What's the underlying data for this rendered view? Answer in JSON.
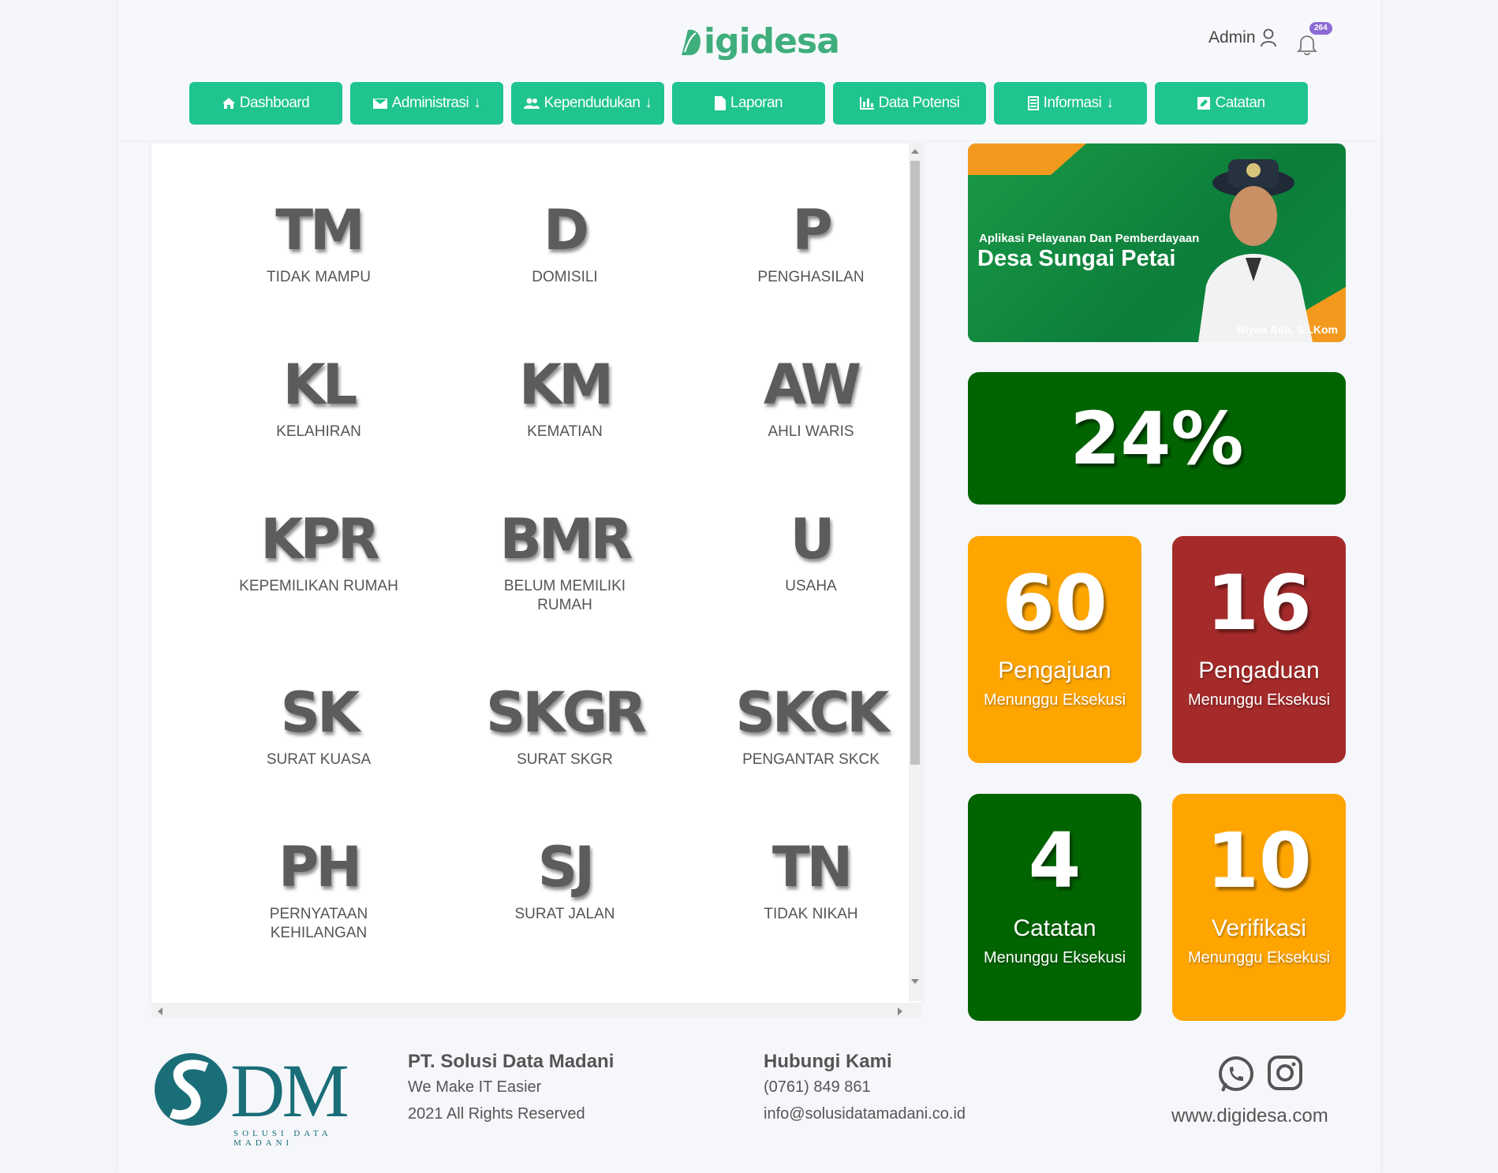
{
  "header": {
    "logo_text": "igidesa",
    "admin_label": "Admin",
    "notif_count": "264"
  },
  "nav": [
    {
      "label": "Dashboard",
      "icon": "home-icon"
    },
    {
      "label": "Administrasi",
      "icon": "envelope-icon"
    },
    {
      "label": "Kependudukan",
      "icon": "users-icon"
    },
    {
      "label": "Laporan",
      "icon": "file-icon"
    },
    {
      "label": "Data Potensi",
      "icon": "bar-chart-icon"
    },
    {
      "label": "Informasi",
      "icon": "list-icon"
    },
    {
      "label": "Catatan",
      "icon": "edit-icon"
    }
  ],
  "letters": [
    {
      "code": "TM",
      "label": "TIDAK MAMPU"
    },
    {
      "code": "D",
      "label": "DOMISILI"
    },
    {
      "code": "P",
      "label": "PENGHASILAN"
    },
    {
      "code": "KL",
      "label": "KELAHIRAN"
    },
    {
      "code": "KM",
      "label": "KEMATIAN"
    },
    {
      "code": "AW",
      "label": "AHLI WARIS"
    },
    {
      "code": "KPR",
      "label": "KEPEMILIKAN RUMAH"
    },
    {
      "code": "BMR",
      "label": "BELUM MEMILIKI RUMAH"
    },
    {
      "code": "U",
      "label": "USAHA"
    },
    {
      "code": "SK",
      "label": "SURAT KUASA"
    },
    {
      "code": "SKGR",
      "label": "SURAT SKGR"
    },
    {
      "code": "SKCK",
      "label": "PENGANTAR SKCK"
    },
    {
      "code": "PH",
      "label": "PERNYATAAN KEHILANGAN"
    },
    {
      "code": "SJ",
      "label": "SURAT JALAN"
    },
    {
      "code": "TN",
      "label": "TIDAK NIKAH"
    }
  ],
  "banner": {
    "tagline": "Aplikasi Pelayanan Dan Pemberdayaan",
    "title": "Desa Sungai Petai",
    "credit": "Riyan Adli, S.I.Kom"
  },
  "percent": "24%",
  "stats": [
    {
      "num": "60",
      "title": "Pengajuan",
      "sub": "Menunggu Eksekusi",
      "color": "#ffa500"
    },
    {
      "num": "16",
      "title": "Pengaduan",
      "sub": "Menunggu Eksekusi",
      "color": "#a52a2a"
    },
    {
      "num": "4",
      "title": "Catatan",
      "sub": "Menunggu Eksekusi",
      "color": "#006400"
    },
    {
      "num": "10",
      "title": "Verifikasi",
      "sub": "Menunggu Eksekusi",
      "color": "#ffa500"
    }
  ],
  "footer": {
    "brand_big": "DM",
    "brand_small": "SOLUSI DATA MADANI",
    "company": "PT. Solusi Data Madani",
    "slogan": "We Make IT Easier",
    "rights": "2021 All Rights Reserved",
    "contact_title": "Hubungi Kami",
    "phone": "(0761) 849 861",
    "email": "info@solusidatamadani.co.id",
    "website": "www.digidesa.com"
  },
  "colors": {
    "nav": "#1fc48f",
    "brand_green": "#3fae7c",
    "dark_green": "#006400",
    "orange": "#ffa500",
    "red": "#a52a2a"
  }
}
